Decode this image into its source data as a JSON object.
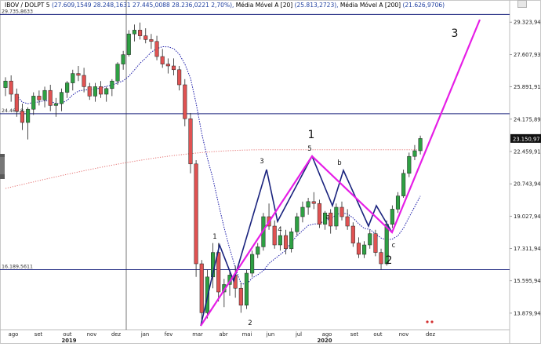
{
  "header": {
    "symbol": "IBOV / DOLPT 5",
    "ohlc": "(27.609,1549  28.248,1631  27.445,0088  28.236,0221  2,70%),",
    "ma20_label": "Média Móvel A [20]",
    "ma20_value": "(25.813,2723),",
    "ma200_label": "Média Móvel A [200]",
    "ma200_value": "(21.626,9706)"
  },
  "price_axis": {
    "ticks": [
      "29.323,94",
      "27.607,93",
      "25.891,91",
      "24.175,89",
      "22.459,91",
      "20.743,94",
      "19.027,94",
      "17.311,94",
      "15.595,94",
      "13.879,94"
    ],
    "last_price": "23.150,97"
  },
  "levels": [
    {
      "label": "29.735,8633",
      "value": 29735.86
    },
    {
      "label": "24.463,8...",
      "value": 24463.8
    },
    {
      "label": "16.189,5611",
      "value": 16189.56
    }
  ],
  "time_axis": {
    "months": [
      "ago",
      "set",
      "out",
      "nov",
      "dez",
      "jan",
      "fev",
      "mar",
      "abr",
      "mai",
      "jun",
      "jul",
      "ago",
      "set",
      "out",
      "nov",
      "dez"
    ],
    "years": [
      "2019",
      "2020"
    ]
  },
  "wave_labels": {
    "big": [
      "1",
      "2",
      "3"
    ],
    "small": [
      "1",
      "2",
      "3",
      "4",
      "5",
      "a",
      "b",
      "c"
    ]
  },
  "colors": {
    "up": "#2ea043",
    "down": "#e05252",
    "levels": "#1a237e",
    "ma20": "#1a1aa8",
    "ma200": "#e57373",
    "wave_magenta": "#e61ee6",
    "wave_navy": "#1a237e",
    "last_price_bg": "#111111"
  },
  "chart_data": {
    "type": "candlestick",
    "title": "IBOV / DOLPT 5",
    "x_range": [
      "2019-07",
      "2020-12"
    ],
    "ylim": [
      13000,
      30000
    ],
    "y_ticks": [
      29323.94,
      27607.93,
      25891.91,
      24175.89,
      22459.91,
      20743.94,
      19027.94,
      17311.94,
      15595.94,
      13879.94
    ],
    "last_close": 23150.97,
    "horizontal_levels": [
      29735.86,
      24463.8,
      16189.56
    ],
    "moving_averages": [
      {
        "name": "Média Móvel A [20]",
        "value": 25813.27
      },
      {
        "name": "Média Móvel A [200]",
        "value": 21626.97
      }
    ],
    "series": [
      {
        "name": "IBOV / DOLPT 5",
        "candles": [
          [
            25850,
            26400,
            25400,
            26200
          ],
          [
            26200,
            26500,
            25100,
            25500
          ],
          [
            25500,
            25800,
            24300,
            24600
          ],
          [
            24600,
            25000,
            23600,
            24000
          ],
          [
            24000,
            24800,
            23100,
            24700
          ],
          [
            24700,
            25600,
            24400,
            25400
          ],
          [
            25400,
            25700,
            24900,
            25200
          ],
          [
            25200,
            25900,
            24800,
            25700
          ],
          [
            25700,
            26000,
            24600,
            24900
          ],
          [
            24900,
            25300,
            24300,
            25000
          ],
          [
            25000,
            25800,
            24600,
            25600
          ],
          [
            25600,
            26200,
            25300,
            26100
          ],
          [
            26100,
            26800,
            25700,
            26600
          ],
          [
            26600,
            27000,
            26200,
            26500
          ],
          [
            26500,
            26900,
            25600,
            25900
          ],
          [
            25900,
            26100,
            25200,
            25400
          ],
          [
            25400,
            26100,
            25100,
            25900
          ],
          [
            25900,
            26200,
            25300,
            25500
          ],
          [
            25500,
            25900,
            25100,
            25800
          ],
          [
            25800,
            26300,
            25400,
            26200
          ],
          [
            26200,
            27200,
            26000,
            27100
          ],
          [
            27100,
            27800,
            26800,
            27600
          ],
          [
            27600,
            28900,
            27500,
            28700
          ],
          [
            28700,
            29200,
            28300,
            28900
          ],
          [
            28900,
            29300,
            28400,
            28600
          ],
          [
            28600,
            29000,
            28200,
            28400
          ],
          [
            28400,
            28700,
            27900,
            28300
          ],
          [
            28300,
            28600,
            27300,
            27500
          ],
          [
            27500,
            27900,
            26900,
            27100
          ],
          [
            27100,
            27400,
            26600,
            27000
          ],
          [
            27000,
            27400,
            26500,
            26800
          ],
          [
            26800,
            27000,
            25700,
            26000
          ],
          [
            26000,
            26300,
            23800,
            24200
          ],
          [
            24200,
            24500,
            21300,
            21800
          ],
          [
            21800,
            22000,
            15800,
            16500
          ],
          [
            16500,
            16700,
            13400,
            13900
          ],
          [
            13900,
            16200,
            13600,
            15800
          ],
          [
            15800,
            17600,
            15200,
            17100
          ],
          [
            17100,
            17600,
            14500,
            15000
          ],
          [
            15000,
            15700,
            14200,
            15400
          ],
          [
            15400,
            16200,
            14800,
            15900
          ],
          [
            15900,
            16400,
            14700,
            15200
          ],
          [
            15200,
            15500,
            13900,
            14300
          ],
          [
            14300,
            16200,
            14100,
            16000
          ],
          [
            16000,
            17200,
            15800,
            17000
          ],
          [
            17000,
            17600,
            16800,
            17400
          ],
          [
            17400,
            19200,
            17200,
            19000
          ],
          [
            19000,
            19700,
            18300,
            18500
          ],
          [
            18500,
            18800,
            17300,
            17500
          ],
          [
            17500,
            18200,
            17200,
            18000
          ],
          [
            18000,
            18300,
            17000,
            17300
          ],
          [
            17300,
            18400,
            17100,
            18200
          ],
          [
            18200,
            19200,
            18000,
            19000
          ],
          [
            19000,
            19800,
            18700,
            19500
          ],
          [
            19500,
            20000,
            19100,
            19800
          ],
          [
            19800,
            20300,
            19400,
            19700
          ],
          [
            19700,
            19900,
            18400,
            18600
          ],
          [
            18600,
            19300,
            18300,
            19200
          ],
          [
            19200,
            19400,
            18100,
            18500
          ],
          [
            18500,
            19700,
            18300,
            19500
          ],
          [
            19500,
            19800,
            18800,
            19000
          ],
          [
            19000,
            19400,
            18300,
            18500
          ],
          [
            18500,
            18700,
            17400,
            17600
          ],
          [
            17600,
            17900,
            16800,
            17000
          ],
          [
            17000,
            17700,
            16800,
            17500
          ],
          [
            17500,
            18300,
            17300,
            18100
          ],
          [
            18100,
            18300,
            16900,
            17100
          ],
          [
            17100,
            17300,
            16200,
            16500
          ],
          [
            16500,
            18800,
            16400,
            18600
          ],
          [
            18600,
            19600,
            18400,
            19400
          ],
          [
            19400,
            20300,
            19200,
            20100
          ],
          [
            20100,
            21500,
            20000,
            21300
          ],
          [
            21300,
            22400,
            21100,
            22200
          ],
          [
            22200,
            22800,
            22000,
            22500
          ],
          [
            22500,
            23300,
            22300,
            23150
          ]
        ]
      }
    ]
  }
}
